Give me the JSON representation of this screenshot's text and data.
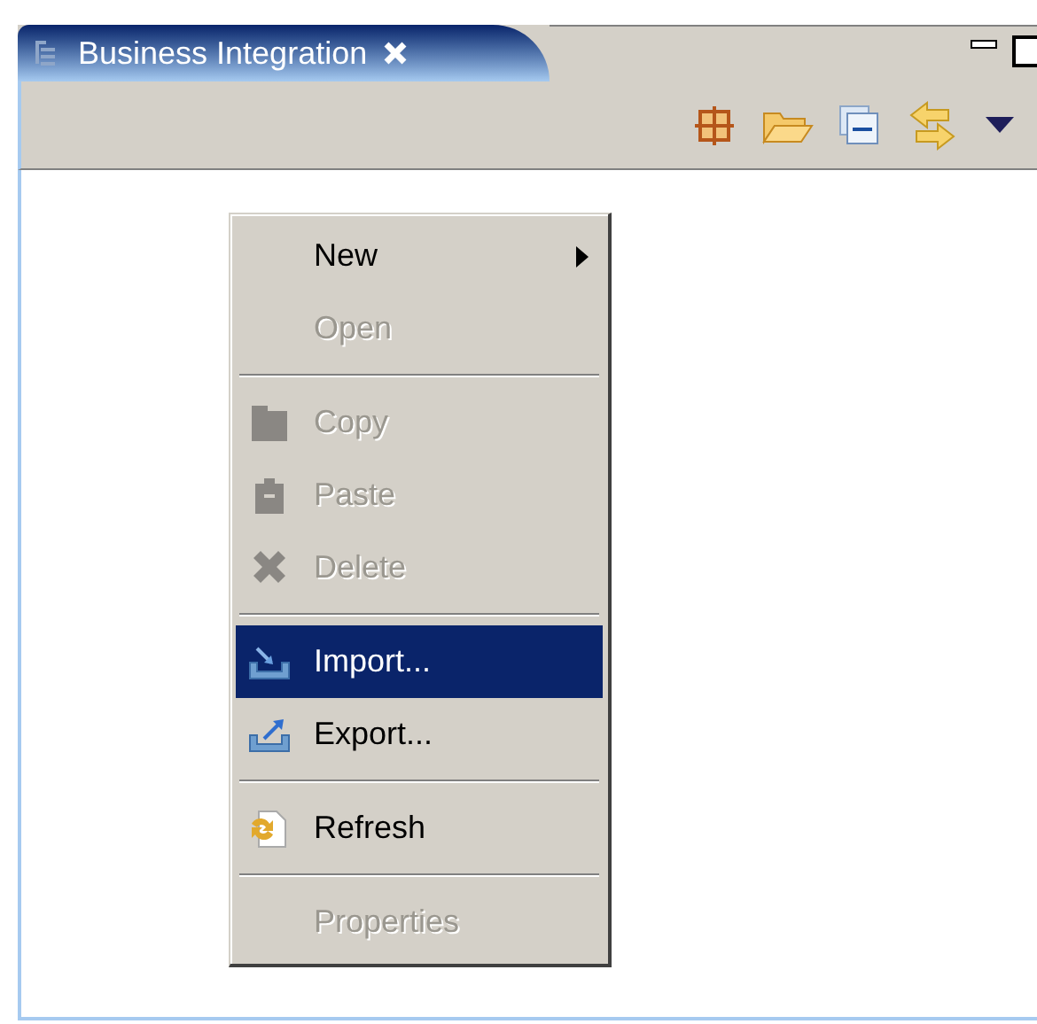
{
  "view": {
    "title": "Business Integration"
  },
  "menu": [
    {
      "kind": "item",
      "label": "New",
      "submenu": true,
      "disabled": false,
      "selected": false
    },
    {
      "kind": "item",
      "label": "Open",
      "submenu": false,
      "disabled": true,
      "selected": false
    },
    {
      "kind": "separator"
    },
    {
      "kind": "item",
      "label": "Copy",
      "submenu": false,
      "disabled": true,
      "selected": false
    },
    {
      "kind": "item",
      "label": "Paste",
      "submenu": false,
      "disabled": true,
      "selected": false
    },
    {
      "kind": "item",
      "label": "Delete",
      "submenu": false,
      "disabled": true,
      "selected": false
    },
    {
      "kind": "separator"
    },
    {
      "kind": "item",
      "label": "Import...",
      "submenu": false,
      "disabled": false,
      "selected": true
    },
    {
      "kind": "item",
      "label": "Export...",
      "submenu": false,
      "disabled": false,
      "selected": false
    },
    {
      "kind": "separator"
    },
    {
      "kind": "item",
      "label": "Refresh",
      "submenu": false,
      "disabled": false,
      "selected": false
    },
    {
      "kind": "separator"
    },
    {
      "kind": "item",
      "label": "Properties",
      "submenu": false,
      "disabled": true,
      "selected": false
    }
  ]
}
